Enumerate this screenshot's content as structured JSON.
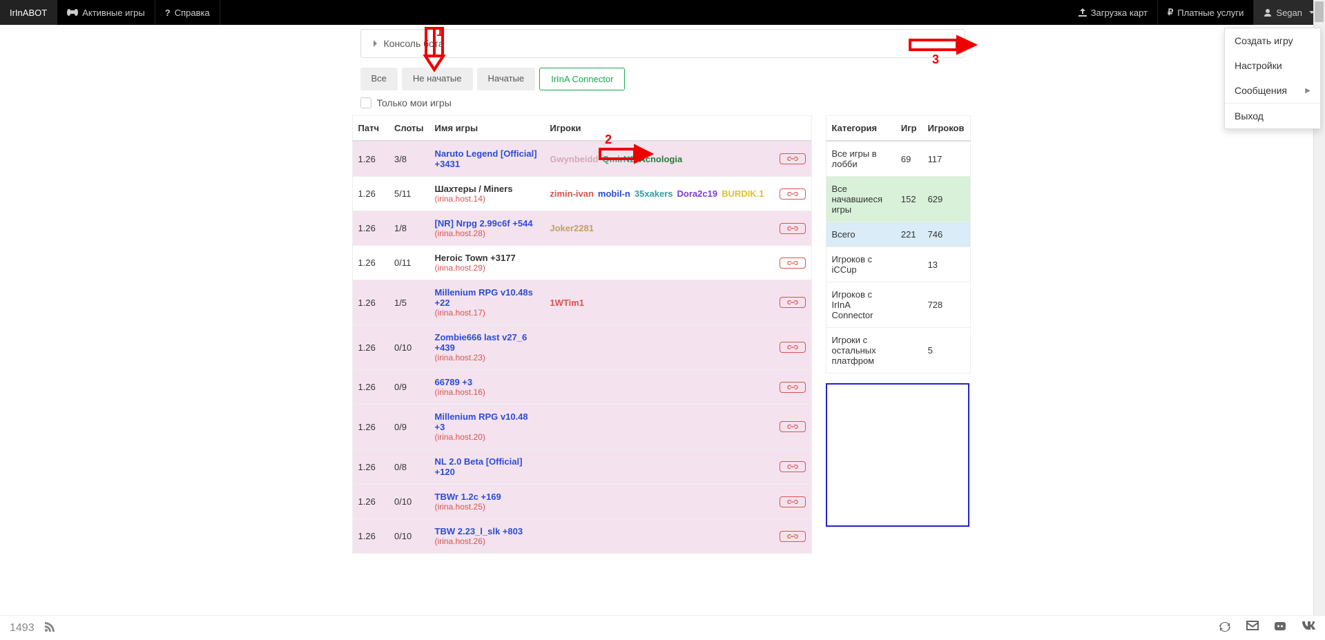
{
  "navbar": {
    "brand": "IrInABOT",
    "active_games": "Активные игры",
    "help": "Справка",
    "upload_maps": "Загрузка карт",
    "paid_services": "Платные услуги",
    "username": "Segan"
  },
  "dropdown": {
    "create_game": "Создать игру",
    "settings": "Настройки",
    "messages": "Сообщения",
    "logout": "Выход"
  },
  "console_label": "Консоль бота",
  "tabs": {
    "all": "Все",
    "not_started": "Не начатые",
    "started": "Начатые",
    "connector": "IrInA Connector"
  },
  "only_mine": "Только мои игры",
  "headers": {
    "patch": "Патч",
    "slots": "Слоты",
    "game_name": "Имя игры",
    "players": "Игроки"
  },
  "games": [
    {
      "patch": "1.26",
      "slots": "3/8",
      "name": "Naruto Legend [Official] +3431",
      "host": "",
      "tinted": true,
      "players": [
        {
          "n": "Gwynbeidd",
          "c": "c-pink"
        },
        {
          "n": "QmirN2",
          "c": "c-teal"
        },
        {
          "n": "Acnologia",
          "c": "c-green"
        }
      ]
    },
    {
      "patch": "1.26",
      "slots": "5/11",
      "name": "Шахтеры / Miners",
      "plain": true,
      "host": "(irina.host.14)",
      "tinted": false,
      "players": [
        {
          "n": "zimin-ivan",
          "c": "c-red"
        },
        {
          "n": "mobil-n",
          "c": "c-blue"
        },
        {
          "n": "35xakers",
          "c": "c-teal2"
        },
        {
          "n": "Dora2c19",
          "c": "c-purple"
        },
        {
          "n": "BURDIK.1",
          "c": "c-yellow"
        }
      ]
    },
    {
      "patch": "1.26",
      "slots": "1/8",
      "name": "[NR] Nrpg 2.99c6f +544",
      "host": "(irina.host.28)",
      "tinted": true,
      "players": [
        {
          "n": "Joker2281",
          "c": "c-tan"
        }
      ]
    },
    {
      "patch": "1.26",
      "slots": "0/11",
      "name": "Heroic Town +3177",
      "plain": true,
      "host": "(irina.host.29)",
      "tinted": false,
      "players": []
    },
    {
      "patch": "1.26",
      "slots": "1/5",
      "name": "Millenium RPG v10.48s +22",
      "host": "(irina.host.17)",
      "tinted": true,
      "players": [
        {
          "n": "1WTim1",
          "c": "c-red"
        }
      ]
    },
    {
      "patch": "1.26",
      "slots": "0/10",
      "name": "Zombie666 last v27_6 +439",
      "host": "(irina.host.23)",
      "tinted": true,
      "players": []
    },
    {
      "patch": "1.26",
      "slots": "0/9",
      "name": "66789 +3",
      "host": "(irina.host.16)",
      "tinted": true,
      "players": []
    },
    {
      "patch": "1.26",
      "slots": "0/9",
      "name": "Millenium RPG v10.48 +3",
      "host": "(irina.host.20)",
      "tinted": true,
      "players": []
    },
    {
      "patch": "1.26",
      "slots": "0/8",
      "name": "NL 2.0 Beta [Official] +120",
      "host": "",
      "tinted": true,
      "players": []
    },
    {
      "patch": "1.26",
      "slots": "0/10",
      "name": "TBWr 1.2c +169",
      "host": "(irina.host.25)",
      "tinted": true,
      "players": []
    },
    {
      "patch": "1.26",
      "slots": "0/10",
      "name": "TBW 2.23_l_slk +803",
      "host": "(irina.host.26)",
      "tinted": true,
      "players": []
    }
  ],
  "side_headers": {
    "category": "Категория",
    "games": "Игр",
    "players": "Игроков"
  },
  "side_rows": [
    {
      "label": "Все игры в лобби",
      "g": "69",
      "p": "117",
      "cls": ""
    },
    {
      "label": "Все начавшиеся игры",
      "g": "152",
      "p": "629",
      "cls": "side-row-green"
    },
    {
      "label": "Всего",
      "g": "221",
      "p": "746",
      "cls": "side-row-blue"
    },
    {
      "label": "Игроков с iCCup",
      "g": "",
      "p": "13",
      "cls": ""
    },
    {
      "label": "Игроков с IrInA Connector",
      "g": "",
      "p": "728",
      "cls": ""
    },
    {
      "label": "Игроки с остальных платфром",
      "g": "",
      "p": "5",
      "cls": ""
    }
  ],
  "annotations": {
    "a1": "1",
    "a2": "2",
    "a3": "3"
  },
  "footer_count": "1493"
}
